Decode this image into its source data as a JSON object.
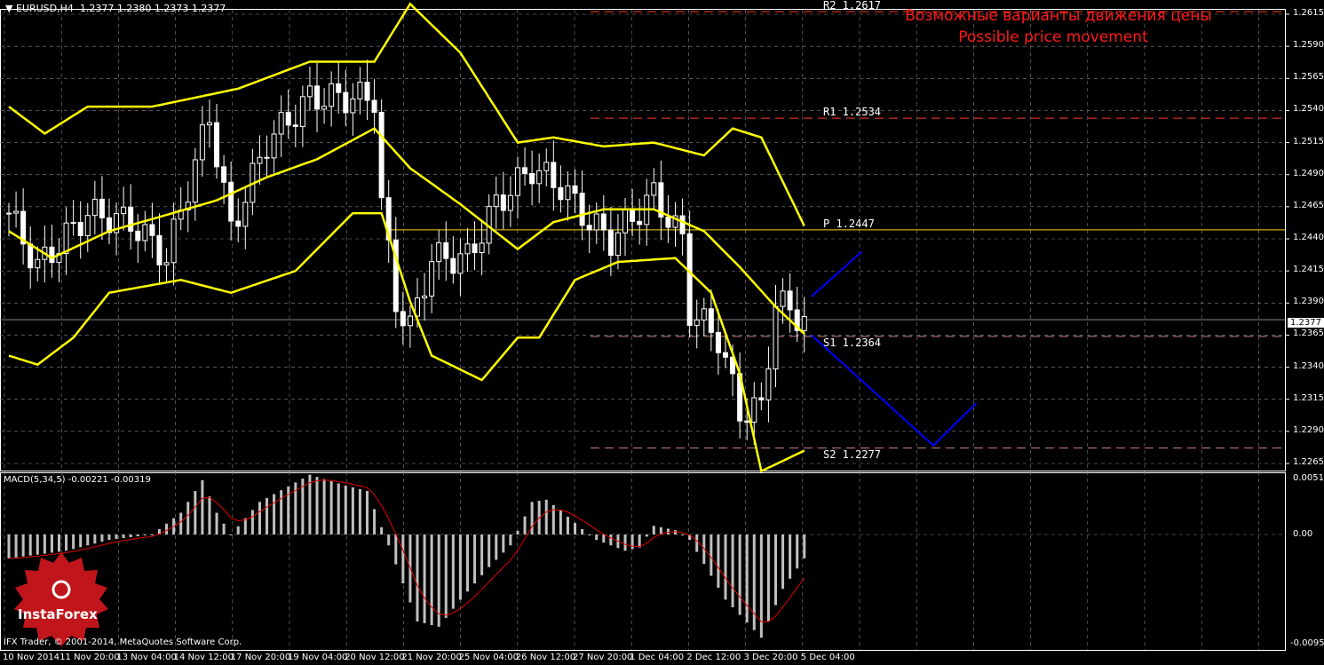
{
  "header": {
    "symbol": "EURUSD,H4",
    "ohlc": "1.2377 1.2380 1.2373 1.2377"
  },
  "annotation": {
    "ru": "Возможные варианты движения цены",
    "en": "Possible price movement"
  },
  "macd": {
    "label": "MACD(5,34,5) -0.00221 -0.00319",
    "ticks": [
      "0.00515",
      "0.00",
      "-0.00959"
    ],
    "histogram_anchors": [
      [
        0,
        -0.0022
      ],
      [
        8,
        -0.0015
      ],
      [
        14,
        -0.0005
      ],
      [
        20,
        0.0
      ],
      [
        24,
        0.002
      ],
      [
        27,
        0.005
      ],
      [
        29,
        0.002
      ],
      [
        31,
        0.0
      ],
      [
        35,
        0.003
      ],
      [
        42,
        0.0055
      ],
      [
        47,
        0.0045
      ],
      [
        50,
        0.004
      ],
      [
        53,
        -0.001
      ],
      [
        57,
        -0.008
      ],
      [
        60,
        -0.0085
      ],
      [
        63,
        -0.006
      ],
      [
        67,
        -0.003
      ],
      [
        70,
        -0.001
      ],
      [
        73,
        0.003
      ],
      [
        75,
        0.0032
      ],
      [
        77,
        0.0022
      ],
      [
        80,
        0.0005
      ],
      [
        82,
        -0.0005
      ],
      [
        86,
        -0.0015
      ],
      [
        88,
        -0.0012
      ],
      [
        90,
        0.0008
      ],
      [
        93,
        0.0004
      ],
      [
        95,
        -0.0005
      ],
      [
        100,
        -0.006
      ],
      [
        105,
        -0.0095
      ],
      [
        108,
        -0.005
      ],
      [
        111,
        -0.0022
      ]
    ],
    "histogram_color": "#c0c0c0",
    "signal_color": "#e00000"
  },
  "footer": {
    "copyright": "IFX Trader, © 2001-2014, MetaQuotes Software Corp."
  },
  "logo": {
    "text": "InstaForex",
    "color": "#c0161b"
  },
  "chart_data": {
    "type": "line",
    "title": "EURUSD,H4",
    "ylim": [
      1.2252,
      1.2626
    ],
    "y_ticks": [
      "1.2615",
      "1.2590",
      "1.2565",
      "1.2540",
      "1.2515",
      "1.2490",
      "1.2465",
      "1.2440",
      "1.2415",
      "1.2390",
      "1.2365",
      "1.2340",
      "1.2315",
      "1.2290",
      "1.2265"
    ],
    "x_ticks": [
      "10 Nov 2014",
      "11 Nov 20:00",
      "13 Nov 04:00",
      "14 Nov 12:00",
      "17 Nov 20:00",
      "19 Nov 04:00",
      "20 Nov 12:00",
      "21 Nov 20:00",
      "25 Nov 04:00",
      "26 Nov 12:00",
      "27 Nov 20:00",
      "1 Dec 04:00",
      "2 Dec 12:00",
      "3 Dec 20:00",
      "5 Dec 04:00"
    ],
    "grid": true,
    "current_price": "1.2377",
    "close_anchors": [
      [
        0,
        1.246
      ],
      [
        4,
        1.2418
      ],
      [
        11,
        1.246
      ],
      [
        17,
        1.2453
      ],
      [
        22,
        1.2425
      ],
      [
        28,
        1.2536
      ],
      [
        31,
        1.2446
      ],
      [
        36,
        1.2515
      ],
      [
        42,
        1.255
      ],
      [
        51,
        1.255
      ],
      [
        52,
        1.2467
      ],
      [
        54,
        1.2391
      ],
      [
        56,
        1.237
      ],
      [
        59,
        1.2425
      ],
      [
        64,
        1.2425
      ],
      [
        68,
        1.2467
      ],
      [
        73,
        1.2495
      ],
      [
        77,
        1.2481
      ],
      [
        81,
        1.2453
      ],
      [
        84,
        1.2439
      ],
      [
        90,
        1.2474
      ],
      [
        94,
        1.2439
      ],
      [
        95,
        1.2384
      ],
      [
        99,
        1.2363
      ],
      [
        102,
        1.2305
      ],
      [
        105,
        1.2308
      ],
      [
        107,
        1.2391
      ],
      [
        111,
        1.2377
      ]
    ],
    "bollinger": {
      "color": "#ffff00",
      "upper": [
        [
          0,
          1.2543
        ],
        [
          5,
          1.2522
        ],
        [
          11,
          1.2543
        ],
        [
          20,
          1.2543
        ],
        [
          32,
          1.2557
        ],
        [
          42,
          1.2578
        ],
        [
          51,
          1.2578
        ],
        [
          56,
          1.2623
        ],
        [
          63,
          1.2585
        ],
        [
          71,
          1.2515
        ],
        [
          76,
          1.2519
        ],
        [
          83,
          1.2512
        ],
        [
          90,
          1.2515
        ],
        [
          97,
          1.2505
        ],
        [
          101,
          1.2526
        ],
        [
          105,
          1.2519
        ],
        [
          111,
          1.245
        ]
      ],
      "middle": [
        [
          0,
          1.2446
        ],
        [
          6,
          1.2425
        ],
        [
          14,
          1.2446
        ],
        [
          21,
          1.2457
        ],
        [
          29,
          1.247
        ],
        [
          36,
          1.2488
        ],
        [
          43,
          1.2502
        ],
        [
          51,
          1.2526
        ],
        [
          56,
          1.2495
        ],
        [
          63,
          1.2467
        ],
        [
          71,
          1.2432
        ],
        [
          76,
          1.2453
        ],
        [
          83,
          1.2463
        ],
        [
          90,
          1.2463
        ],
        [
          97,
          1.2446
        ],
        [
          102,
          1.2418
        ],
        [
          107,
          1.2387
        ],
        [
          111,
          1.2366
        ]
      ],
      "lower": [
        [
          0,
          1.2349
        ],
        [
          4,
          1.2342
        ],
        [
          9,
          1.2363
        ],
        [
          14,
          1.2398
        ],
        [
          24,
          1.2408
        ],
        [
          31,
          1.2398
        ],
        [
          40,
          1.2415
        ],
        [
          48,
          1.246
        ],
        [
          52,
          1.246
        ],
        [
          56,
          1.2391
        ],
        [
          59,
          1.2349
        ],
        [
          66,
          1.233
        ],
        [
          71,
          1.2363
        ],
        [
          74,
          1.2363
        ],
        [
          79,
          1.2408
        ],
        [
          85,
          1.2422
        ],
        [
          93,
          1.2425
        ],
        [
          98,
          1.2398
        ],
        [
          102,
          1.2335
        ],
        [
          105,
          1.2259
        ],
        [
          111,
          1.2275
        ]
      ]
    },
    "pivots": [
      {
        "label": "R2",
        "value": "1.2617",
        "price": 1.2617,
        "color": "#ff3b1f",
        "style": "dashed"
      },
      {
        "label": "R1",
        "value": "1.2534",
        "price": 1.2534,
        "color": "#ff3b1f",
        "style": "dashed"
      },
      {
        "label": "P",
        "value": "1.2447",
        "price": 1.2447,
        "color": "#ffd700",
        "style": "solid"
      },
      {
        "label": "S1",
        "value": "1.2364",
        "price": 1.2364,
        "color": "#d08080",
        "style": "dashed"
      },
      {
        "label": "S2",
        "value": "1.2277",
        "price": 1.2277,
        "color": "#d08080",
        "style": "dashed"
      }
    ],
    "projection_color": "#0000ff",
    "projections": [
      [
        [
          112,
          1.2395
        ],
        [
          119,
          1.243
        ]
      ],
      [
        [
          112,
          1.2365
        ],
        [
          129,
          1.2279
        ],
        [
          135,
          1.2312
        ]
      ]
    ]
  }
}
